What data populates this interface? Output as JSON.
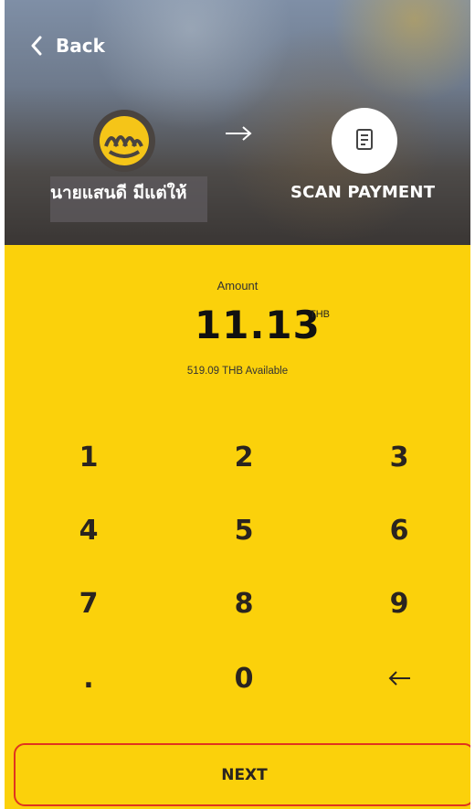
{
  "header": {
    "back_label": "Back",
    "payee_name": "นายแสนดี มีแต่ให้",
    "scan_label": "SCAN PAYMENT",
    "bank_logo": "kasikorn-logo",
    "arrow_icon": "arrow-right-icon",
    "scan_icon": "receipt-icon"
  },
  "amount": {
    "label": "Amount",
    "value": "11.13",
    "currency": "THB",
    "available": "519.09 THB Available"
  },
  "keypad": {
    "keys": [
      "1",
      "2",
      "3",
      "4",
      "5",
      "6",
      "7",
      "8",
      "9",
      ".",
      "0"
    ],
    "backspace_icon": "backspace-arrow-icon"
  },
  "footer": {
    "next_label": "NEXT"
  },
  "colors": {
    "background": "#FBD10B",
    "text": "#2a2420",
    "highlight_border": "#E0341F",
    "logo_gold": "#F5C518"
  }
}
